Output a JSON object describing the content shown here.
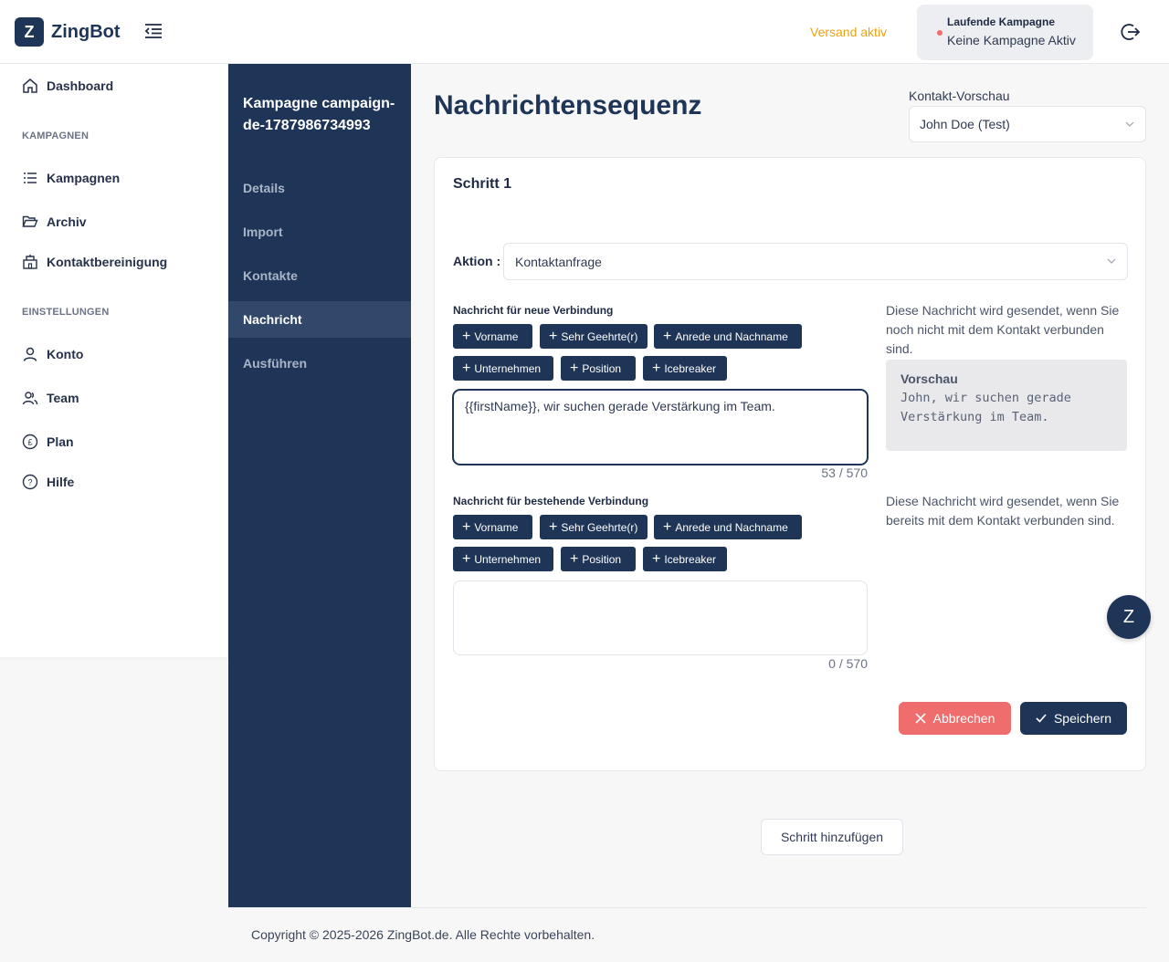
{
  "brand": {
    "mark": "Z",
    "name": "ZingBot"
  },
  "topbar": {
    "status": "Versand aktiv",
    "campaign_title": "Laufende Kampagne",
    "campaign_status": "Keine Kampagne Aktiv"
  },
  "sidebar": {
    "dashboard": "Dashboard",
    "section_campaigns": "KAMPAGNEN",
    "campaigns": "Kampagnen",
    "archive": "Archiv",
    "cleanup": "Kontaktbereinigung",
    "section_settings": "EINSTELLUNGEN",
    "account": "Konto",
    "team": "Team",
    "plan": "Plan",
    "help": "Hilfe"
  },
  "campaign_nav": {
    "title": "Kampagne campaign-de-1787986734993",
    "items": [
      "Details",
      "Import",
      "Kontakte",
      "Nachricht",
      "Ausführen"
    ],
    "active": "Nachricht"
  },
  "main": {
    "title": "Nachrichtensequenz",
    "preview_label": "Kontakt-Vorschau",
    "preview_value": "John Doe (Test)"
  },
  "step": {
    "title": "Schritt 1",
    "action_label": "Aktion",
    "action_colon": ":",
    "action_value": "Kontaktanfrage",
    "new_connection": {
      "label": "Nachricht für neue Verbindung",
      "chips": [
        "Vorname",
        "Sehr Geehrte(r)",
        "Anrede und Nachname",
        "Unternehmen",
        "Position",
        "Icebreaker"
      ],
      "text": "{{firstName}}, wir suchen gerade Verstärkung im Team.",
      "counter": "53 / 570",
      "help": "Diese Nachricht wird gesendet, wenn Sie noch nicht mit dem Kontakt verbunden sind.",
      "preview_title": "Vorschau",
      "preview_text": "John, wir suchen gerade Verstärkung im Team."
    },
    "existing_connection": {
      "label": "Nachricht für bestehende Verbindung",
      "chips": [
        "Vorname",
        "Sehr Geehrte(r)",
        "Anrede und Nachname",
        "Unternehmen",
        "Position",
        "Icebreaker"
      ],
      "text": "",
      "counter": "0 / 570",
      "help": "Diese Nachricht wird gesendet, wenn Sie bereits mit dem Kontakt verbunden sind."
    },
    "cancel": "Abbrechen",
    "save": "Speichern"
  },
  "add_step": "Schritt hinzufügen",
  "fab": "Z",
  "footer": "Copyright © 2025-2026 ZingBot.de. Alle Rechte vorbehalten.",
  "colors": {
    "primary": "#1e3557",
    "danger": "#f06d6d",
    "warning": "#e8a317"
  }
}
